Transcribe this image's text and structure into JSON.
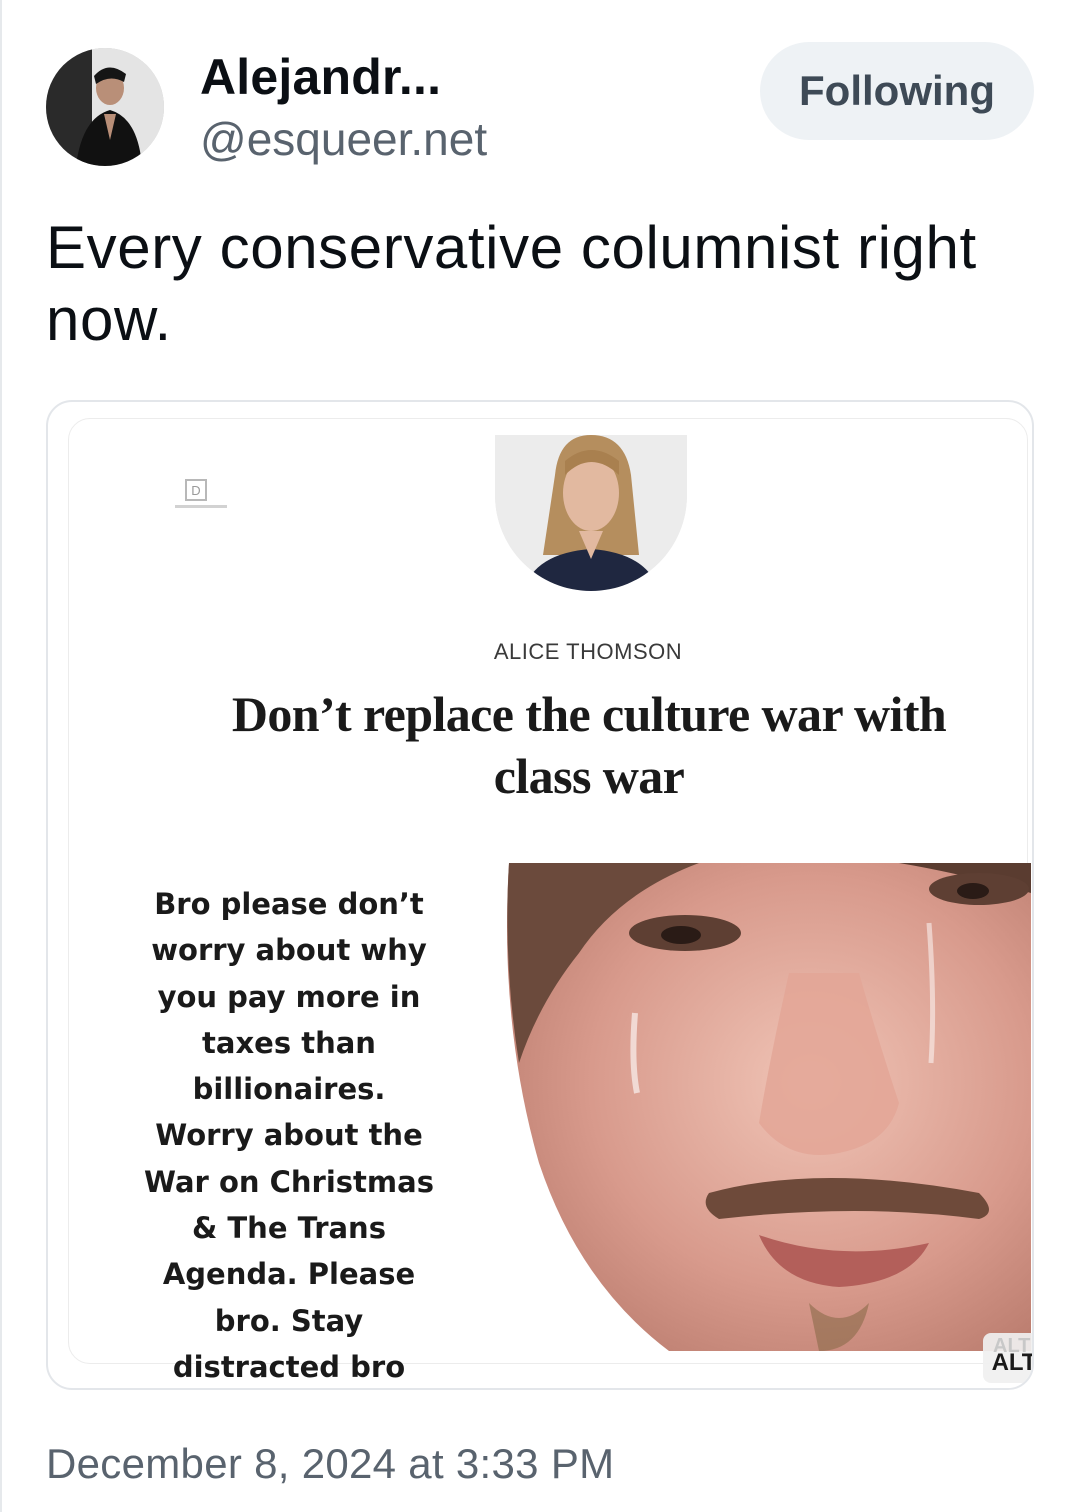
{
  "author": {
    "display_name": "Alejandr...",
    "handle": "@esqueer.net"
  },
  "follow_button": {
    "label": "Following"
  },
  "post": {
    "text": "Every conservative columnist right now.",
    "timestamp": "December 8, 2024 at 3:33 PM"
  },
  "embedded_image": {
    "logo_letter": "D",
    "byline": "ALICE THOMSON",
    "headline": "Don’t replace the culture war with class war",
    "caption": "Bro please don’t worry about why you pay more in taxes than billionaires. Worry about the War on Christmas & The Trans Agenda. Please bro. Stay distracted bro",
    "alt_badge": "ALT",
    "alt_badge_ghost": "ALT"
  },
  "colors": {
    "text_primary": "#0b0f14",
    "text_secondary": "#59636e",
    "button_bg": "#eef2f5",
    "border": "#e3e6ea"
  }
}
